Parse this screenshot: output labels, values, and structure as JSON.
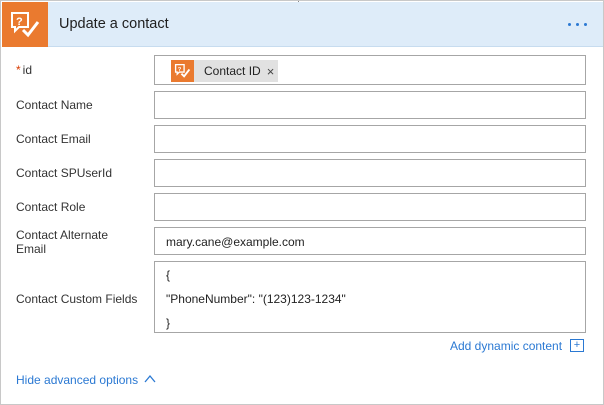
{
  "action": {
    "title": "Update a contact",
    "app_icon": "question-check-icon",
    "menu_icon": "more-ellipsis-icon",
    "accent_color": "#ea7a2f",
    "header_bg": "#deecf9",
    "link_color": "#2b79d3"
  },
  "fields": {
    "id": {
      "label": "id",
      "required_marker": "*",
      "token_label": "Contact ID",
      "token_remove": "×"
    },
    "name": {
      "label": "Contact Name",
      "value": ""
    },
    "email": {
      "label": "Contact Email",
      "value": ""
    },
    "spuserid": {
      "label": "Contact SPUserId",
      "value": ""
    },
    "role": {
      "label": "Contact Role",
      "value": ""
    },
    "alt_email": {
      "label_line1": "Contact Alternate",
      "label_line2": "Email",
      "value": "mary.cane@example.com"
    },
    "custom": {
      "label": "Contact Custom Fields",
      "lines": [
        "{",
        "\"PhoneNumber\": \"(123)123-1234\"",
        "}"
      ]
    }
  },
  "links": {
    "add_dynamic": "Add dynamic content",
    "add_dynamic_icon": "+",
    "hide_advanced": "Hide advanced options"
  }
}
